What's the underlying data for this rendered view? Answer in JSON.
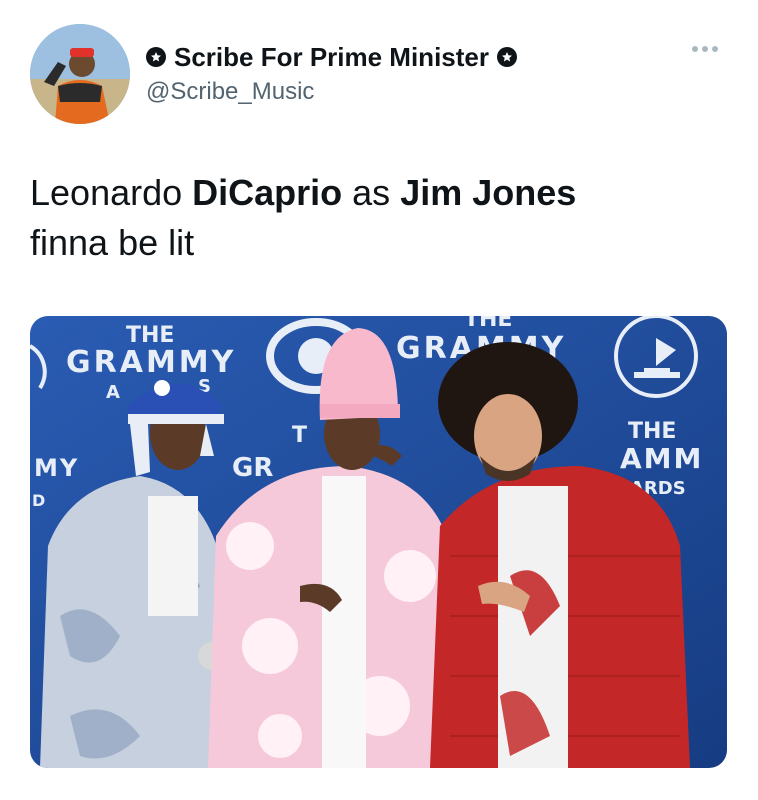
{
  "user": {
    "display_name": "Scribe For Prime Minister",
    "handle": "@Scribe_Music"
  },
  "tweet": {
    "text_parts": [
      {
        "text": "Leonardo ",
        "bold": false
      },
      {
        "text": "DiCaprio",
        "bold": true
      },
      {
        "text": " as ",
        "bold": false
      },
      {
        "text": "Jim Jones",
        "bold": true
      },
      {
        "text": "finna be lit",
        "bold": false,
        "newline": true
      }
    ]
  },
  "image": {
    "backdrop_text": {
      "left_the": "THE",
      "left_grammy": "GRAMMY",
      "left_a": "A",
      "left_s": "S",
      "left_my": "MY",
      "left_d": "D",
      "center_t": "T",
      "center_gr": "GR",
      "right_the": "THE",
      "right_grammy": "GRAMMY",
      "far_right_the": "THE",
      "far_right_amm": "AMM",
      "far_right_ards": "ARDS"
    },
    "colors": {
      "backdrop": "#1f4fa3",
      "backdrop_dark": "#163c82"
    }
  }
}
